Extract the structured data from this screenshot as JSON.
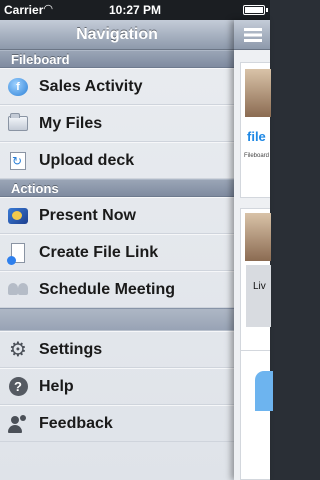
{
  "status_bar": {
    "carrier": "Carrier",
    "time": "10:27 PM"
  },
  "navbar": {
    "title": "Navigation"
  },
  "sections": [
    {
      "header": "Fileboard",
      "items": [
        {
          "label": "Sales Activity",
          "icon": "fileboard-cloud-icon"
        },
        {
          "label": "My Files",
          "icon": "folder-icon"
        },
        {
          "label": "Upload deck",
          "icon": "upload-icon"
        }
      ]
    },
    {
      "header": "Actions",
      "items": [
        {
          "label": "Present Now",
          "icon": "present-icon"
        },
        {
          "label": "Create File Link",
          "icon": "file-link-icon"
        },
        {
          "label": "Schedule Meeting",
          "icon": "meeting-icon"
        }
      ]
    }
  ],
  "bottom_items": [
    {
      "label": "Settings",
      "icon": "gear-icon"
    },
    {
      "label": "Help",
      "icon": "help-icon"
    },
    {
      "label": "Feedback",
      "icon": "feedback-icon"
    }
  ],
  "content_peek": {
    "card1": {
      "logo_text": "file",
      "caption": "Fileboard"
    },
    "card2": {
      "partial_text": "Liv"
    }
  },
  "colors": {
    "navbar": "#8d99ab",
    "section_header": "#8794a8",
    "menu_bg": "#e6e9ee",
    "accent_blue": "#1e88e5"
  }
}
